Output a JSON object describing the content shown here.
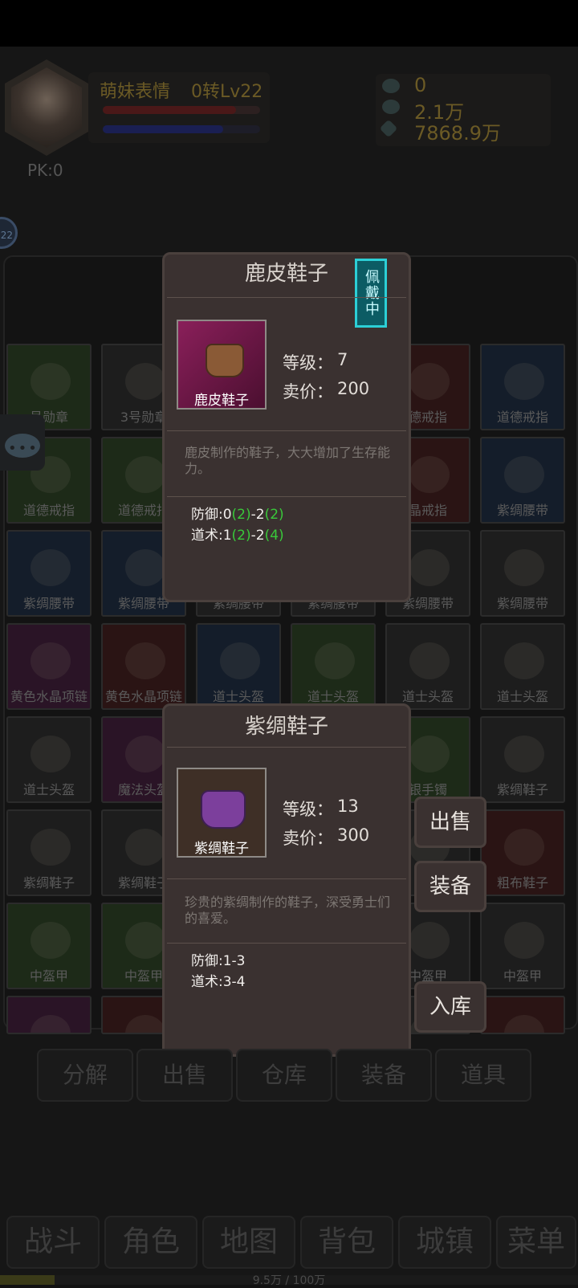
{
  "player": {
    "name": "萌妹表情",
    "level": "0转Lv22",
    "pk": "PK:0",
    "badge": "22"
  },
  "currency": [
    {
      "icon": "ingot-icon",
      "value": "0"
    },
    {
      "icon": "ingot-icon",
      "value": "2.1万"
    },
    {
      "icon": "coin-icon",
      "value": "7868.9万"
    }
  ],
  "inventory": [
    [
      {
        "label": "号勋章",
        "color": "#1d2a18"
      },
      {
        "label": "3号勋章",
        "color": "#1d1d1d"
      },
      {
        "label": "",
        "color": "#1d1d1d"
      },
      {
        "label": "",
        "color": "#1d1d1d"
      },
      {
        "label": "德戒指",
        "color": "#2a1414"
      },
      {
        "label": "道德戒指",
        "color": "#141d2a"
      }
    ],
    [
      {
        "label": "道德戒指",
        "color": "#1d2a18"
      },
      {
        "label": "道德戒指",
        "color": "#1d2a18"
      },
      {
        "label": "",
        "color": "#1d1d1d"
      },
      {
        "label": "",
        "color": "#1d1d1d"
      },
      {
        "label": "晶戒指",
        "color": "#2a1414"
      },
      {
        "label": "紫绸腰带",
        "color": "#141d2a"
      }
    ],
    [
      {
        "label": "紫绸腰带",
        "color": "#141d2a"
      },
      {
        "label": "紫绸腰带",
        "color": "#141d2a"
      },
      {
        "label": "紫绸腰带",
        "color": "#1d1d1d"
      },
      {
        "label": "紫绸腰带",
        "color": "#1d1d1d"
      },
      {
        "label": "紫绸腰带",
        "color": "#1d1d1d"
      },
      {
        "label": "紫绸腰带",
        "color": "#1d1d1d"
      }
    ],
    [
      {
        "label": "黄色水晶项链",
        "color": "#2a1426"
      },
      {
        "label": "黄色水晶项链",
        "color": "#2a1414"
      },
      {
        "label": "道士头盔",
        "color": "#141d2a"
      },
      {
        "label": "道士头盔",
        "color": "#1d2a18"
      },
      {
        "label": "道士头盔",
        "color": "#1d1d1d"
      },
      {
        "label": "道士头盔",
        "color": "#1d1d1d"
      }
    ],
    [
      {
        "label": "道士头盔",
        "color": "#1d1d1d"
      },
      {
        "label": "魔法头盔",
        "color": "#2a1426"
      },
      {
        "label": "",
        "color": "#1d1d1d"
      },
      {
        "label": "",
        "color": "#1d1d1d"
      },
      {
        "label": "银手镯",
        "color": "#1d2a18"
      },
      {
        "label": "紫绸鞋子",
        "color": "#1d1d1d"
      }
    ],
    [
      {
        "label": "紫绸鞋子",
        "color": "#1d1d1d"
      },
      {
        "label": "紫绸鞋子",
        "color": "#1d1d1d"
      },
      {
        "label": "",
        "color": "#1d1d1d"
      },
      {
        "label": "",
        "color": "#1d1d1d"
      },
      {
        "label": "",
        "color": "#1d1d1d"
      },
      {
        "label": "粗布鞋子",
        "color": "#2a1414"
      }
    ],
    [
      {
        "label": "中盔甲",
        "color": "#1d2a18"
      },
      {
        "label": "中盔甲",
        "color": "#1d2a18"
      },
      {
        "label": "",
        "color": "#1d1d1d"
      },
      {
        "label": "",
        "color": "#1d1d1d"
      },
      {
        "label": "中盔甲",
        "color": "#1d1d1d"
      },
      {
        "label": "中盔甲",
        "color": "#1d1d1d"
      }
    ],
    [
      {
        "label": "",
        "color": "#2a1426"
      },
      {
        "label": "",
        "color": "#2a1414"
      },
      {
        "label": "",
        "color": "#1d1d1d"
      },
      {
        "label": "",
        "color": "#1d1d1d"
      },
      {
        "label": "",
        "color": "#1d1d1d"
      },
      {
        "label": "",
        "color": "#2a1414"
      }
    ]
  ],
  "popup_equipped": {
    "title": "鹿皮鞋子",
    "badge": "佩戴中",
    "thumb_label": "鹿皮鞋子",
    "level_label": "等级：",
    "level_value": "7",
    "price_label": "卖价：",
    "price_value": "200",
    "description": "鹿皮制作的鞋子，大大增加了生存能力。",
    "defense": {
      "prefix": "防御:0",
      "g1": "(2)",
      "mid": "-2",
      "g2": "(2)"
    },
    "taoism": {
      "prefix": "道术:1",
      "g1": "(2)",
      "mid": "-2",
      "g2": "(4)"
    }
  },
  "popup_item": {
    "title": "紫绸鞋子",
    "thumb_label": "紫绸鞋子",
    "level_label": "等级：",
    "level_value": "13",
    "price_label": "卖价：",
    "price_value": "300",
    "description": "珍贵的紫绸制作的鞋子，深受勇士们的喜爱。",
    "defense": "防御:1-3",
    "taoism": "道术:3-4"
  },
  "actions": {
    "sell": "出售",
    "equip": "装备",
    "store": "入库"
  },
  "bag_tabs": [
    "分解",
    "出售",
    "仓库",
    "装备",
    "道具"
  ],
  "nav_tabs": [
    "战斗",
    "角色",
    "地图",
    "背包",
    "城镇",
    "菜单"
  ],
  "exp": {
    "text": "9.5万 / 100万",
    "fraction": 0.095
  },
  "colors": {
    "popup_bg": "#3a3130",
    "green_bonus": "#39c83a",
    "equip_badge": "#2ccfd6"
  }
}
